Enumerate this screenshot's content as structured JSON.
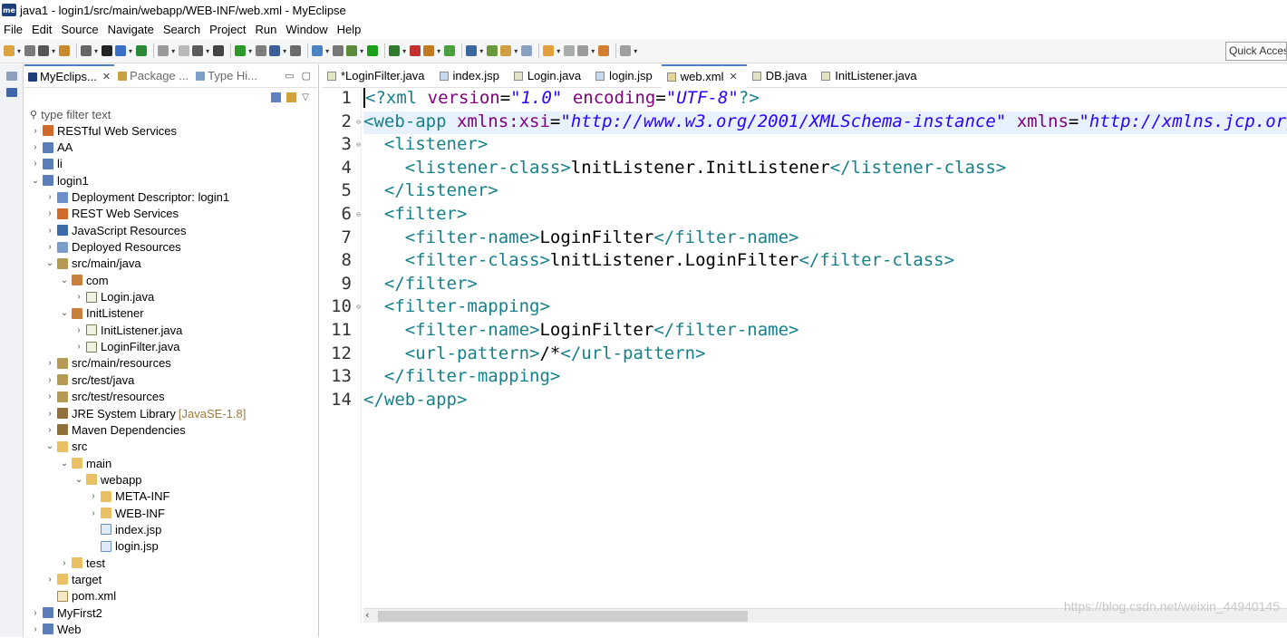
{
  "window": {
    "logo_text": "me",
    "title": "java1 - login1/src/main/webapp/WEB-INF/web.xml - MyEclipse"
  },
  "menu": [
    "File",
    "Edit",
    "Source",
    "Navigate",
    "Search",
    "Project",
    "Run",
    "Window",
    "Help"
  ],
  "toolbar": {
    "quick_access": "Quick Access"
  },
  "explorer": {
    "tabs": [
      {
        "label": "MyEclips...",
        "active": true
      },
      {
        "label": "Package ...",
        "active": false
      },
      {
        "label": "Type Hi...",
        "active": false
      }
    ],
    "filter_placeholder": "type filter text",
    "tree": [
      {
        "label": "RESTful Web Services",
        "indent": 0,
        "arrow": "›",
        "icon": "rest"
      },
      {
        "label": "AA",
        "indent": 0,
        "arrow": "›",
        "icon": "proj"
      },
      {
        "label": "li",
        "indent": 0,
        "arrow": "›",
        "icon": "proj"
      },
      {
        "label": "login1",
        "indent": 0,
        "arrow": "⌄",
        "icon": "proj"
      },
      {
        "label": "Deployment Descriptor: login1",
        "indent": 1,
        "arrow": "›",
        "icon": "desc"
      },
      {
        "label": "REST Web Services",
        "indent": 1,
        "arrow": "›",
        "icon": "rest"
      },
      {
        "label": "JavaScript Resources",
        "indent": 1,
        "arrow": "›",
        "icon": "js"
      },
      {
        "label": "Deployed Resources",
        "indent": 1,
        "arrow": "›",
        "icon": "deploy"
      },
      {
        "label": "src/main/java",
        "indent": 1,
        "arrow": "⌄",
        "icon": "srcfold"
      },
      {
        "label": "com",
        "indent": 2,
        "arrow": "⌄",
        "icon": "pkg"
      },
      {
        "label": "Login.java",
        "indent": 3,
        "arrow": "›",
        "icon": "java"
      },
      {
        "label": "InitListener",
        "indent": 2,
        "arrow": "⌄",
        "icon": "pkg"
      },
      {
        "label": "InitListener.java",
        "indent": 3,
        "arrow": "›",
        "icon": "java"
      },
      {
        "label": "LoginFilter.java",
        "indent": 3,
        "arrow": "›",
        "icon": "java"
      },
      {
        "label": "src/main/resources",
        "indent": 1,
        "arrow": "›",
        "icon": "srcfold"
      },
      {
        "label": "src/test/java",
        "indent": 1,
        "arrow": "›",
        "icon": "srcfold"
      },
      {
        "label": "src/test/resources",
        "indent": 1,
        "arrow": "›",
        "icon": "srcfold"
      },
      {
        "label": "JRE System Library",
        "indent": 1,
        "arrow": "›",
        "icon": "lib",
        "suffix": "[JavaSE-1.8]"
      },
      {
        "label": "Maven Dependencies",
        "indent": 1,
        "arrow": "›",
        "icon": "lib"
      },
      {
        "label": "src",
        "indent": 1,
        "arrow": "⌄",
        "icon": "folder"
      },
      {
        "label": "main",
        "indent": 2,
        "arrow": "⌄",
        "icon": "folder"
      },
      {
        "label": "webapp",
        "indent": 3,
        "arrow": "⌄",
        "icon": "folder"
      },
      {
        "label": "META-INF",
        "indent": 4,
        "arrow": "›",
        "icon": "folder"
      },
      {
        "label": "WEB-INF",
        "indent": 4,
        "arrow": "›",
        "icon": "folder"
      },
      {
        "label": "index.jsp",
        "indent": 4,
        "arrow": "",
        "icon": "jsp"
      },
      {
        "label": "login.jsp",
        "indent": 4,
        "arrow": "",
        "icon": "jsp"
      },
      {
        "label": "test",
        "indent": 2,
        "arrow": "›",
        "icon": "folder"
      },
      {
        "label": "target",
        "indent": 1,
        "arrow": "›",
        "icon": "folder"
      },
      {
        "label": "pom.xml",
        "indent": 1,
        "arrow": "",
        "icon": "xml"
      },
      {
        "label": "MyFirst2",
        "indent": 0,
        "arrow": "›",
        "icon": "proj"
      },
      {
        "label": "Web",
        "indent": 0,
        "arrow": "›",
        "icon": "proj"
      }
    ]
  },
  "editor": {
    "tabs": [
      {
        "label": "*LoginFilter.java",
        "active": false,
        "icon": "java"
      },
      {
        "label": "index.jsp",
        "active": false,
        "icon": "jsp"
      },
      {
        "label": "Login.java",
        "active": false,
        "icon": "java"
      },
      {
        "label": "login.jsp",
        "active": false,
        "icon": "jsp"
      },
      {
        "label": "web.xml",
        "active": true,
        "icon": "xml"
      },
      {
        "label": "DB.java",
        "active": false,
        "icon": "java"
      },
      {
        "label": "InitListener.java",
        "active": false,
        "icon": "java"
      }
    ],
    "lines": [
      {
        "no": "1",
        "fold": false,
        "tokens": [
          [
            "tag",
            "<?xml "
          ],
          [
            "attr",
            "version"
          ],
          [
            "txt",
            "="
          ],
          [
            "val",
            "\"1.0\""
          ],
          [
            "txt",
            " "
          ],
          [
            "attr",
            "encoding"
          ],
          [
            "txt",
            "="
          ],
          [
            "val",
            "\"UTF-8\""
          ],
          [
            "tag",
            "?>"
          ]
        ]
      },
      {
        "no": "2",
        "fold": true,
        "tokens": [
          [
            "tag",
            "<web-app "
          ],
          [
            "attr",
            "xmlns:xsi"
          ],
          [
            "txt",
            "="
          ],
          [
            "val",
            "\"http://www.w3.org/2001/XMLSchema-instance\""
          ],
          [
            "txt",
            " "
          ],
          [
            "attr",
            "xmlns"
          ],
          [
            "txt",
            "="
          ],
          [
            "val",
            "\"http://xmlns.jcp.org/xml/ns/javaee\""
          ]
        ]
      },
      {
        "no": "3",
        "fold": true,
        "tokens": [
          [
            "txt",
            "  "
          ],
          [
            "tag",
            "<listener>"
          ]
        ]
      },
      {
        "no": "4",
        "fold": false,
        "tokens": [
          [
            "txt",
            "    "
          ],
          [
            "tag",
            "<listener-class>"
          ],
          [
            "txt",
            "lnitListener.InitListener"
          ],
          [
            "tag",
            "</listener-class>"
          ]
        ]
      },
      {
        "no": "5",
        "fold": false,
        "tokens": [
          [
            "txt",
            "  "
          ],
          [
            "tag",
            "</listener>"
          ]
        ]
      },
      {
        "no": "6",
        "fold": true,
        "tokens": [
          [
            "txt",
            "  "
          ],
          [
            "tag",
            "<filter>"
          ]
        ]
      },
      {
        "no": "7",
        "fold": false,
        "tokens": [
          [
            "txt",
            "    "
          ],
          [
            "tag",
            "<filter-name>"
          ],
          [
            "txt",
            "LoginFilter"
          ],
          [
            "tag",
            "</filter-name>"
          ]
        ]
      },
      {
        "no": "8",
        "fold": false,
        "tokens": [
          [
            "txt",
            "    "
          ],
          [
            "tag",
            "<filter-class>"
          ],
          [
            "txt",
            "lnitListener.LoginFilter"
          ],
          [
            "tag",
            "</filter-class>"
          ]
        ]
      },
      {
        "no": "9",
        "fold": false,
        "tokens": [
          [
            "txt",
            "  "
          ],
          [
            "tag",
            "</filter>"
          ]
        ]
      },
      {
        "no": "10",
        "fold": true,
        "tokens": [
          [
            "txt",
            "  "
          ],
          [
            "tag",
            "<filter-mapping>"
          ]
        ]
      },
      {
        "no": "11",
        "fold": false,
        "tokens": [
          [
            "txt",
            "    "
          ],
          [
            "tag",
            "<filter-name>"
          ],
          [
            "txt",
            "LoginFilter"
          ],
          [
            "tag",
            "</filter-name>"
          ]
        ]
      },
      {
        "no": "12",
        "fold": false,
        "tokens": [
          [
            "txt",
            "    "
          ],
          [
            "tag",
            "<url-pattern>"
          ],
          [
            "txt",
            "/*"
          ],
          [
            "tag",
            "</url-pattern>"
          ]
        ]
      },
      {
        "no": "13",
        "fold": false,
        "tokens": [
          [
            "txt",
            "  "
          ],
          [
            "tag",
            "</filter-mapping>"
          ]
        ]
      },
      {
        "no": "14",
        "fold": false,
        "tokens": [
          [
            "tag",
            "</web-app>"
          ]
        ]
      }
    ]
  },
  "watermark": "https://blog.csdn.net/weixin_44940145"
}
